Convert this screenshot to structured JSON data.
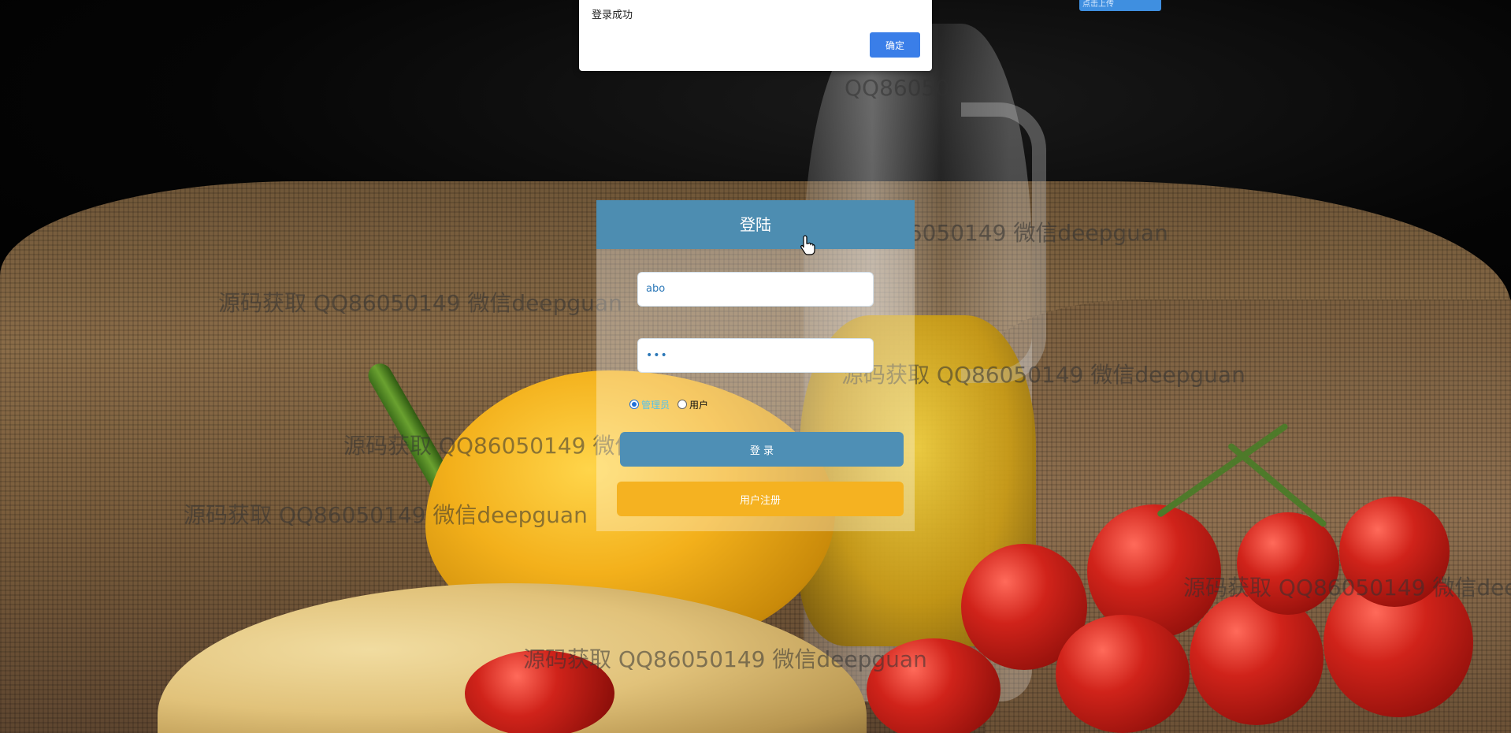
{
  "alert": {
    "message": "登录成功",
    "ok_label": "确定"
  },
  "badge": {
    "label": "点击上传"
  },
  "login": {
    "title": "登陆",
    "username_value": "abo",
    "password_value": "•••",
    "roles": [
      {
        "label": "管理员",
        "selected": true
      },
      {
        "label": "用户",
        "selected": false
      }
    ],
    "login_label": "登 录",
    "register_label": "用户注册"
  },
  "watermark": {
    "text_full": "源码获取 QQ86050149 微信deepguan",
    "text_short": "QQ86050"
  },
  "colors": {
    "panel_header": "#4d8db1",
    "login_button": "#4e8fb5",
    "register_button": "#f5b221",
    "alert_ok": "#3a7ee8"
  }
}
